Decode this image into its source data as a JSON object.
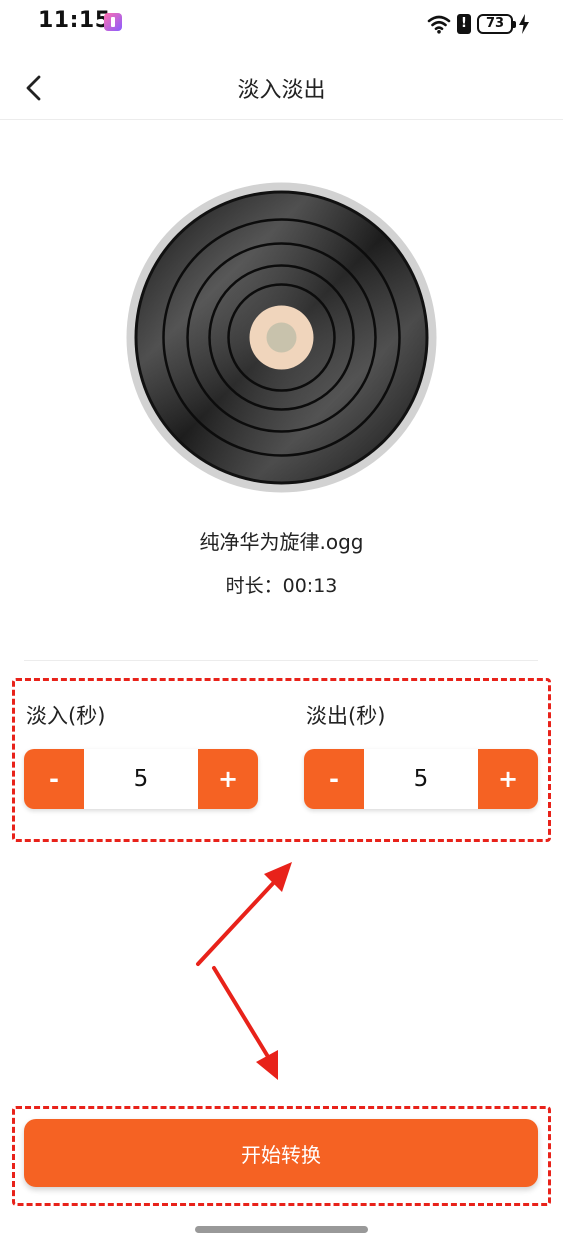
{
  "status_bar": {
    "time": "11:15",
    "battery_level": "73",
    "icons": [
      "app-icon",
      "wifi-icon",
      "alert-icon",
      "battery-icon",
      "charging-bolt-icon"
    ]
  },
  "nav": {
    "title": "淡入淡出",
    "back_icon": "chevron-left-icon"
  },
  "media": {
    "file_name": "纯净华为旋律.ogg",
    "duration_label": "时长",
    "duration_sep": "：",
    "duration_value": "00:13"
  },
  "fade_in": {
    "label": "淡入(秒)",
    "decrement_label": "-",
    "value": "5",
    "increment_label": "+"
  },
  "fade_out": {
    "label": "淡出(秒)",
    "decrement_label": "-",
    "value": "5",
    "increment_label": "+"
  },
  "actions": {
    "start_label": "开始转换"
  },
  "colors": {
    "accent": "#f56223",
    "annotation": "#e8221a",
    "record_center": "#f0d5bc",
    "record_spindle": "#c8c2ac"
  }
}
